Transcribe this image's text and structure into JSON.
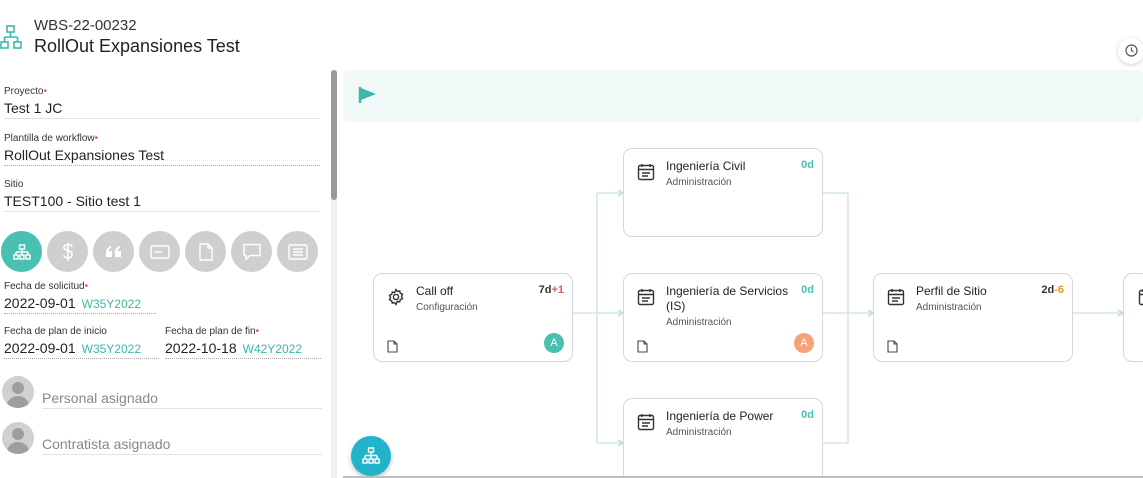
{
  "header": {
    "code": "WBS-22-00232",
    "title": "RollOut Expansiones Test"
  },
  "form": {
    "proyecto": {
      "label": "Proyecto",
      "value": "Test 1 JC"
    },
    "plantilla": {
      "label": "Plantilla de workflow",
      "value": "RollOut Expansiones Test"
    },
    "sitio": {
      "label": "Sitio",
      "value": "TEST100 - Sitio test 1"
    },
    "fecha_solicitud": {
      "label": "Fecha de solicitud",
      "value": "2022-09-01",
      "week": "W35Y2022"
    },
    "fecha_inicio": {
      "label": "Fecha de plan de inicio",
      "value": "2022-09-01",
      "week": "W35Y2022"
    },
    "fecha_fin": {
      "label": "Fecha de plan de fin",
      "value": "2022-10-18",
      "week": "W42Y2022"
    },
    "required_mark": "•"
  },
  "toolbar_icons": [
    "workflow-icon",
    "dollar-icon",
    "quote-icon",
    "card-icon",
    "document-icon",
    "comment-icon",
    "list-icon"
  ],
  "personal": {
    "label": "Personal asignado"
  },
  "contratista": {
    "label": "Contratista asignado"
  },
  "nodes": {
    "call_off": {
      "title": "Call off",
      "sub": "Configuración",
      "dur": "7d",
      "delta": "+1",
      "badge": "A"
    },
    "civil": {
      "title": "Ingeniería Civil",
      "sub": "Administración",
      "dur": "0d"
    },
    "servicios": {
      "title": "Ingeniería de Servicios (IS)",
      "sub": "Administración",
      "dur": "0d",
      "badge": "A"
    },
    "power": {
      "title": "Ingeniería de Power",
      "sub": "Administración",
      "dur": "0d"
    },
    "perfil": {
      "title": "Perfil de Sitio",
      "sub": "Administración",
      "dur": "2d",
      "delta": "-6"
    }
  },
  "colors": {
    "accent": "#4ac0b2",
    "fab": "#21b3c9",
    "badge_orange": "#f4a27a",
    "delta_positive": "#e05a5a",
    "delta_negative": "#e8912c"
  }
}
